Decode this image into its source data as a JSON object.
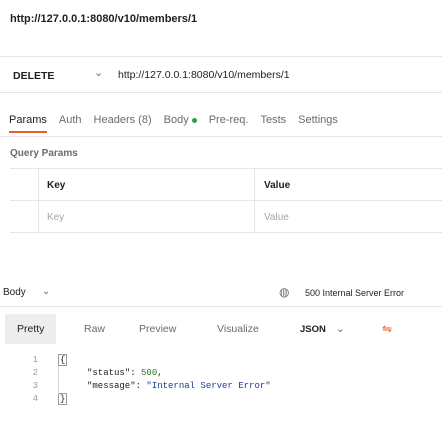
{
  "request": {
    "title": "http://127.0.0.1:8080/v10/members/1",
    "method": "DELETE",
    "url": "http://127.0.0.1:8080/v10/members/1"
  },
  "request_tabs": [
    {
      "label": "Params",
      "active": true
    },
    {
      "label": "Auth",
      "active": false
    },
    {
      "label": "Headers (8)",
      "active": false
    },
    {
      "label": "Body",
      "active": false,
      "indicator": true
    },
    {
      "label": "Pre-req.",
      "active": false
    },
    {
      "label": "Tests",
      "active": false
    },
    {
      "label": "Settings",
      "active": false
    }
  ],
  "query_params": {
    "label": "Query Params",
    "col_key": "Key",
    "col_value": "Value",
    "placeholder_key": "Key",
    "placeholder_value": "Value"
  },
  "response": {
    "body_label": "Body",
    "status": "500 Internal Server Error",
    "tabs": [
      {
        "label": "Pretty",
        "active": true
      },
      {
        "label": "Raw",
        "active": false
      },
      {
        "label": "Preview",
        "active": false
      },
      {
        "label": "Visualize",
        "active": false
      }
    ],
    "format": "JSON",
    "lines": [
      {
        "n": "1",
        "text": "{"
      },
      {
        "n": "2",
        "key": "\"status\"",
        "value": "500",
        "suffix": ","
      },
      {
        "n": "3",
        "key": "\"message\"",
        "value": "\"Internal Server Error\""
      },
      {
        "n": "4",
        "text": "}"
      }
    ]
  },
  "colors": {
    "accent": "#e85d28",
    "indicator": "#2a9d55"
  }
}
